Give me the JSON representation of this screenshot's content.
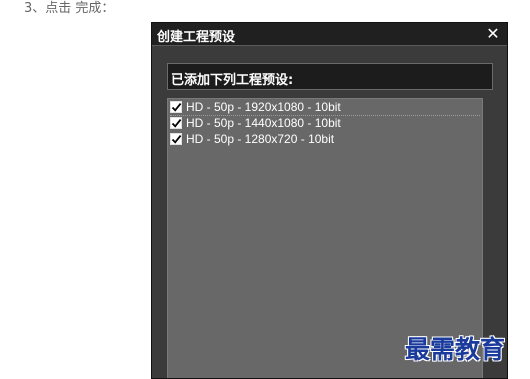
{
  "instruction": {
    "text": "3、点击 完成："
  },
  "dialog": {
    "title": "创建工程预设",
    "close_label": "✕",
    "header_label": "已添加下列工程预设:",
    "presets": [
      {
        "label": "HD - 50p - 1920x1080 - 10bit",
        "checked": true
      },
      {
        "label": "HD - 50p - 1440x1080 - 10bit",
        "checked": true
      },
      {
        "label": "HD - 50p - 1280x720 - 10bit",
        "checked": true
      }
    ]
  },
  "watermark": {
    "text": "最需教育"
  },
  "colors": {
    "dialog_background": "#3b3b3b",
    "titlebar": "#202020",
    "list_background": "#686868",
    "watermark": "#1a3a9c"
  },
  "icons": {
    "close": "close-icon",
    "checkbox": "checkmark-icon"
  }
}
